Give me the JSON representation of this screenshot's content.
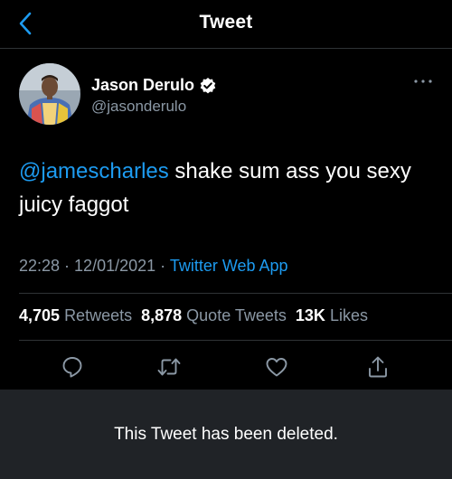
{
  "header": {
    "title": "Tweet",
    "back_icon": "chevron-left-icon"
  },
  "author": {
    "display_name": "Jason Derulo",
    "handle": "@jasonderulo",
    "verified": true,
    "verified_icon": "verified-badge-icon"
  },
  "more_icon": "ellipsis-icon",
  "tweet": {
    "mention": "@jamescharles",
    "text": " shake sum ass you sexy juicy faggot",
    "time": "22:28",
    "separator": " · ",
    "date": "12/01/2021",
    "source": "Twitter Web App"
  },
  "stats": {
    "retweets_count": "4,705",
    "retweets_label": "Retweets",
    "quote_count": "8,878",
    "quote_label": "Quote Tweets",
    "likes_count": "13K",
    "likes_label": "Likes"
  },
  "actions": {
    "reply_icon": "reply-icon",
    "retweet_icon": "retweet-icon",
    "like_icon": "heart-icon",
    "share_icon": "share-icon"
  },
  "banner": {
    "text": "This Tweet has been deleted."
  },
  "colors": {
    "background": "#000000",
    "accent": "#1d9bf0",
    "secondary_text": "#8b98a5",
    "divider": "#2f3336",
    "banner_background": "#202327"
  }
}
